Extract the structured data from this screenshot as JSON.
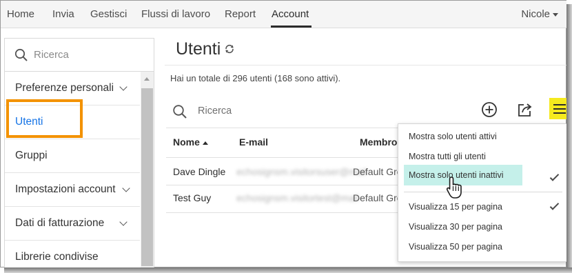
{
  "nav": {
    "items": [
      {
        "label": "Home",
        "active": false
      },
      {
        "label": "Invia",
        "active": false
      },
      {
        "label": "Gestisci",
        "active": false
      },
      {
        "label": "Flussi di lavoro",
        "active": false
      },
      {
        "label": "Report",
        "active": false
      },
      {
        "label": "Account",
        "active": true
      }
    ],
    "user": "Nicole"
  },
  "sidebar": {
    "search_placeholder": "Ricerca",
    "items": [
      {
        "label": "Preferenze personali",
        "expandable": true
      },
      {
        "label": "Utenti",
        "expandable": false,
        "selected": true
      },
      {
        "label": "Gruppi",
        "expandable": false
      },
      {
        "label": "Impostazioni account",
        "expandable": true
      },
      {
        "label": "Dati di fatturazione",
        "expandable": true
      },
      {
        "label": "Librerie condivise",
        "expandable": false
      }
    ]
  },
  "main": {
    "title": "Utenti",
    "summary": "Hai un totale di 296 utenti (168 sono attivi).",
    "search_placeholder": "Ricerca",
    "table": {
      "columns": [
        "Nome",
        "E-mail",
        "Membro"
      ],
      "rows": [
        {
          "name": "Dave Dingle",
          "email": "echosignsm.visitorsuser@mail",
          "member": "Default Gro"
        },
        {
          "name": "Test Guy",
          "email": "echosignsm.visitortest@mail",
          "member": "Default Gro"
        }
      ]
    }
  },
  "menu": {
    "filter_items": [
      {
        "label": "Mostra solo utenti attivi",
        "checked": false
      },
      {
        "label": "Mostra tutti gli utenti",
        "checked": false
      },
      {
        "label": "Mostra solo utenti inattivi",
        "checked": true
      }
    ],
    "page_items": [
      {
        "label": "Visualizza 15 per pagina",
        "checked": true
      },
      {
        "label": "Visualizza 30 per pagina",
        "checked": false
      },
      {
        "label": "Visualizza 50 per pagina",
        "checked": false
      }
    ]
  },
  "colors": {
    "accent": "#1473e6",
    "highlight_outline": "#f39200",
    "menu_button": "#f5ea1e",
    "hover_item": "#c5f0ea"
  }
}
